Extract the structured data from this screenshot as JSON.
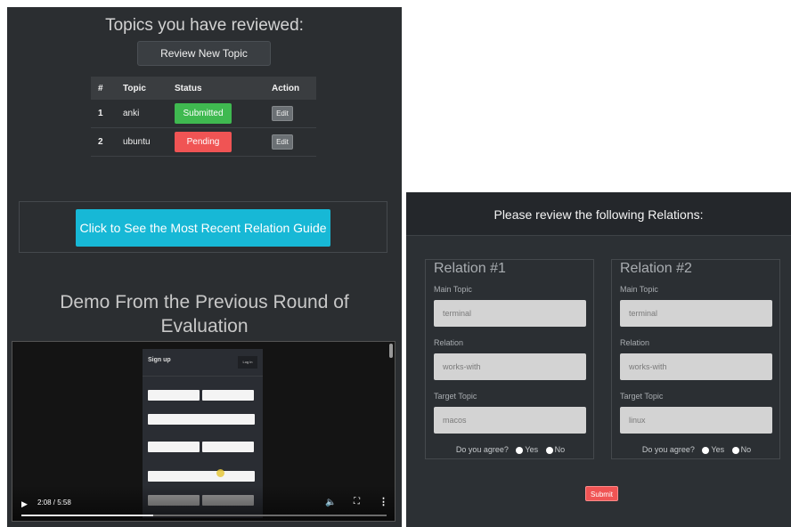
{
  "left": {
    "title": "Topics you have reviewed:",
    "review_new_label": "Review New Topic",
    "table": {
      "headers": [
        "#",
        "Topic",
        "Status",
        "Action"
      ],
      "rows": [
        {
          "num": "1",
          "topic": "anki",
          "status": "Submitted",
          "action": "Edit"
        },
        {
          "num": "2",
          "topic": "ubuntu",
          "status": "Pending",
          "action": "Edit"
        }
      ]
    },
    "guide_button": "Click to See the Most Recent Relation Guide",
    "demo_title": "Demo From the Previous Round of Evaluation",
    "video": {
      "signup_title": "Sign up",
      "login_label": "Log in",
      "time": "2:08 / 5:58",
      "progress": 0.36
    }
  },
  "right": {
    "header": "Please review the following Relations:",
    "relations": [
      {
        "title": "Relation #1",
        "main_topic_label": "Main Topic",
        "main_topic": "terminal",
        "relation_label": "Relation",
        "relation": "works-with",
        "target_topic_label": "Target Topic",
        "target_topic": "macos",
        "agree_label": "Do you agree?",
        "yes": "Yes",
        "no": "No"
      },
      {
        "title": "Relation #2",
        "main_topic_label": "Main Topic",
        "main_topic": "terminal",
        "relation_label": "Relation",
        "relation": "works-with",
        "target_topic_label": "Target Topic",
        "target_topic": "linux",
        "agree_label": "Do you agree?",
        "yes": "Yes",
        "no": "No"
      }
    ],
    "submit_label": "Submit"
  },
  "colors": {
    "submitted": "#3fb950",
    "pending": "#f05454",
    "guide": "#17b8d6",
    "submit": "#f05454"
  }
}
